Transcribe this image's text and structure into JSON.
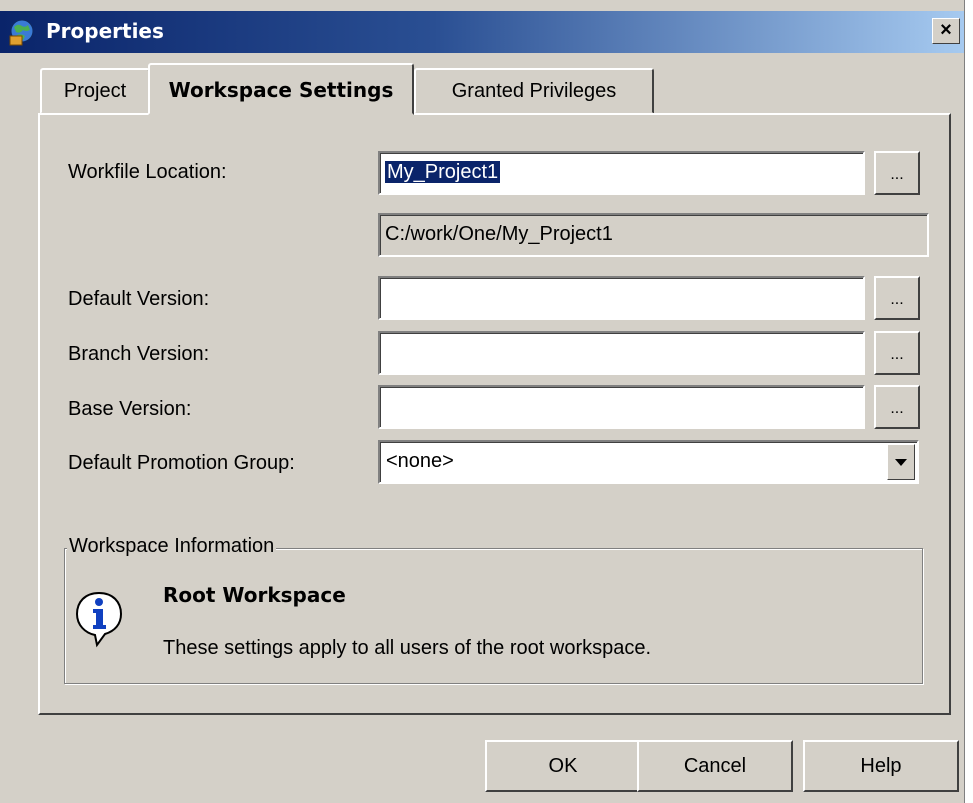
{
  "window": {
    "title": "Properties",
    "app_icon": "globe-app-icon",
    "close_glyph": "×"
  },
  "tabs": [
    {
      "label": "Project",
      "active": false
    },
    {
      "label": "Workspace Settings",
      "active": true
    },
    {
      "label": "Granted Privileges",
      "active": false
    }
  ],
  "form": {
    "workfile_location": {
      "label": "Workfile Location:",
      "value": "My_Project1",
      "resolved_path": "C:/work/One/My_Project1"
    },
    "default_version": {
      "label": "Default Version:",
      "value": ""
    },
    "branch_version": {
      "label": "Branch Version:",
      "value": ""
    },
    "base_version": {
      "label": "Base Version:",
      "value": ""
    },
    "promotion_group": {
      "label": "Default Promotion Group:",
      "selected": "<none>"
    },
    "browse_label": "..."
  },
  "workspace_info": {
    "legend": "Workspace Information",
    "icon": "info-icon",
    "heading": "Root Workspace",
    "text": "These settings apply to all users of the root workspace."
  },
  "buttons": {
    "ok": "OK",
    "cancel": "Cancel",
    "help": "Help"
  },
  "colors": {
    "title_start": "#0a246a",
    "title_end": "#a6caf0",
    "face": "#d4d0c8",
    "selection": "#0a246a"
  }
}
